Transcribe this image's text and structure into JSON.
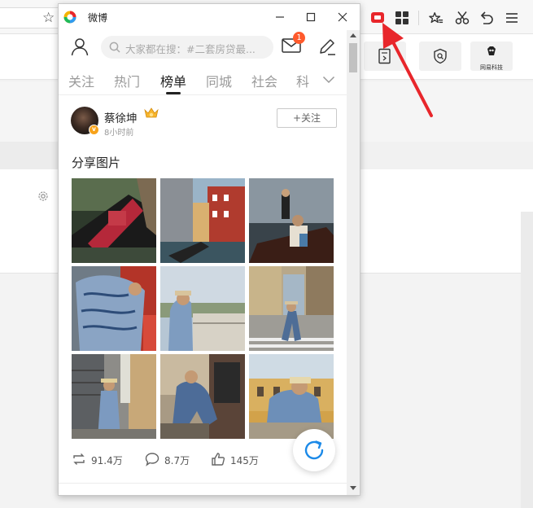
{
  "window": {
    "title": "微博"
  },
  "search": {
    "placeholder": "大家都在搜：#二套房贷最..."
  },
  "notifications": {
    "mail_count": "1"
  },
  "tabs": [
    {
      "label": "关注",
      "active": false
    },
    {
      "label": "热门",
      "active": false
    },
    {
      "label": "榜单",
      "active": true
    },
    {
      "label": "同城",
      "active": false
    },
    {
      "label": "社会",
      "active": false
    },
    {
      "label": "科",
      "active": false
    }
  ],
  "post": {
    "author": "蔡徐坤",
    "time": "8小时前",
    "follow_label": "+关注",
    "text": "分享图片",
    "reposts": "91.4万",
    "comments": "8.7万",
    "likes": "145万"
  },
  "background": {
    "extension_label": "网易科技"
  },
  "colors": {
    "accent_red": "#e8262b",
    "badge_orange": "#ff5a2c",
    "refresh_blue": "#1c8ae8"
  }
}
